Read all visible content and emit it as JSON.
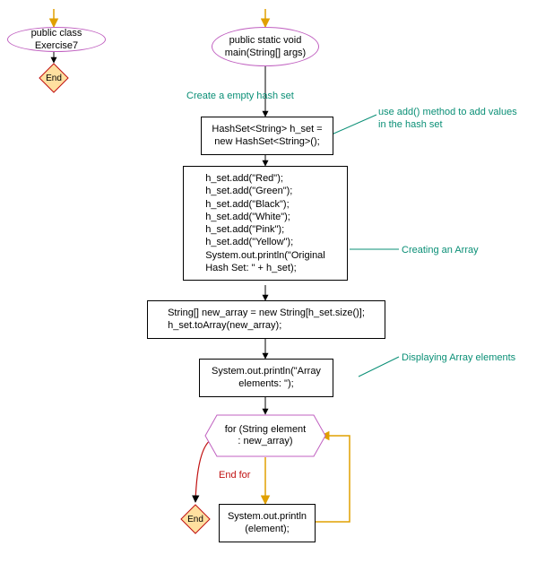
{
  "left": {
    "class_label": "public class Exercise7",
    "end_label": "End"
  },
  "main": {
    "method_label": "public static void\nmain(String[] args)",
    "anno_create_hashset": "Create a empty hash set",
    "box_hashset_decl": "HashSet<String> h_set =\nnew HashSet<String>();",
    "anno_add_method": "use add() method to add\nvalues in the hash set",
    "box_adds": "h_set.add(\"Red\");\nh_set.add(\"Green\");\nh_set.add(\"Black\");\nh_set.add(\"White\");\nh_set.add(\"Pink\");\nh_set.add(\"Yellow\");\nSystem.out.println(\"Original\nHash Set: \" + h_set);",
    "anno_creating_array": "Creating an Array",
    "box_new_array": "String[] new_array = new String[h_set.size()];\nh_set.toArray(new_array);",
    "anno_display": "Displaying Array elements",
    "box_print_header": "System.out.println(\"Array\nelements: \");",
    "for_label": "for (String element\n: new_array)",
    "end_for_label": "End for",
    "end_label": "End",
    "box_print_element": "System.out.println\n(element);"
  },
  "colors": {
    "annotation": "#0a8f76",
    "ellipse_border": "#c060c0",
    "diamond_stroke": "#c01010",
    "diamond_fill": "#ffe0a0",
    "hex_stroke": "#c060c0",
    "arrow_orange": "#e0a000",
    "arrow_black": "#000000"
  }
}
